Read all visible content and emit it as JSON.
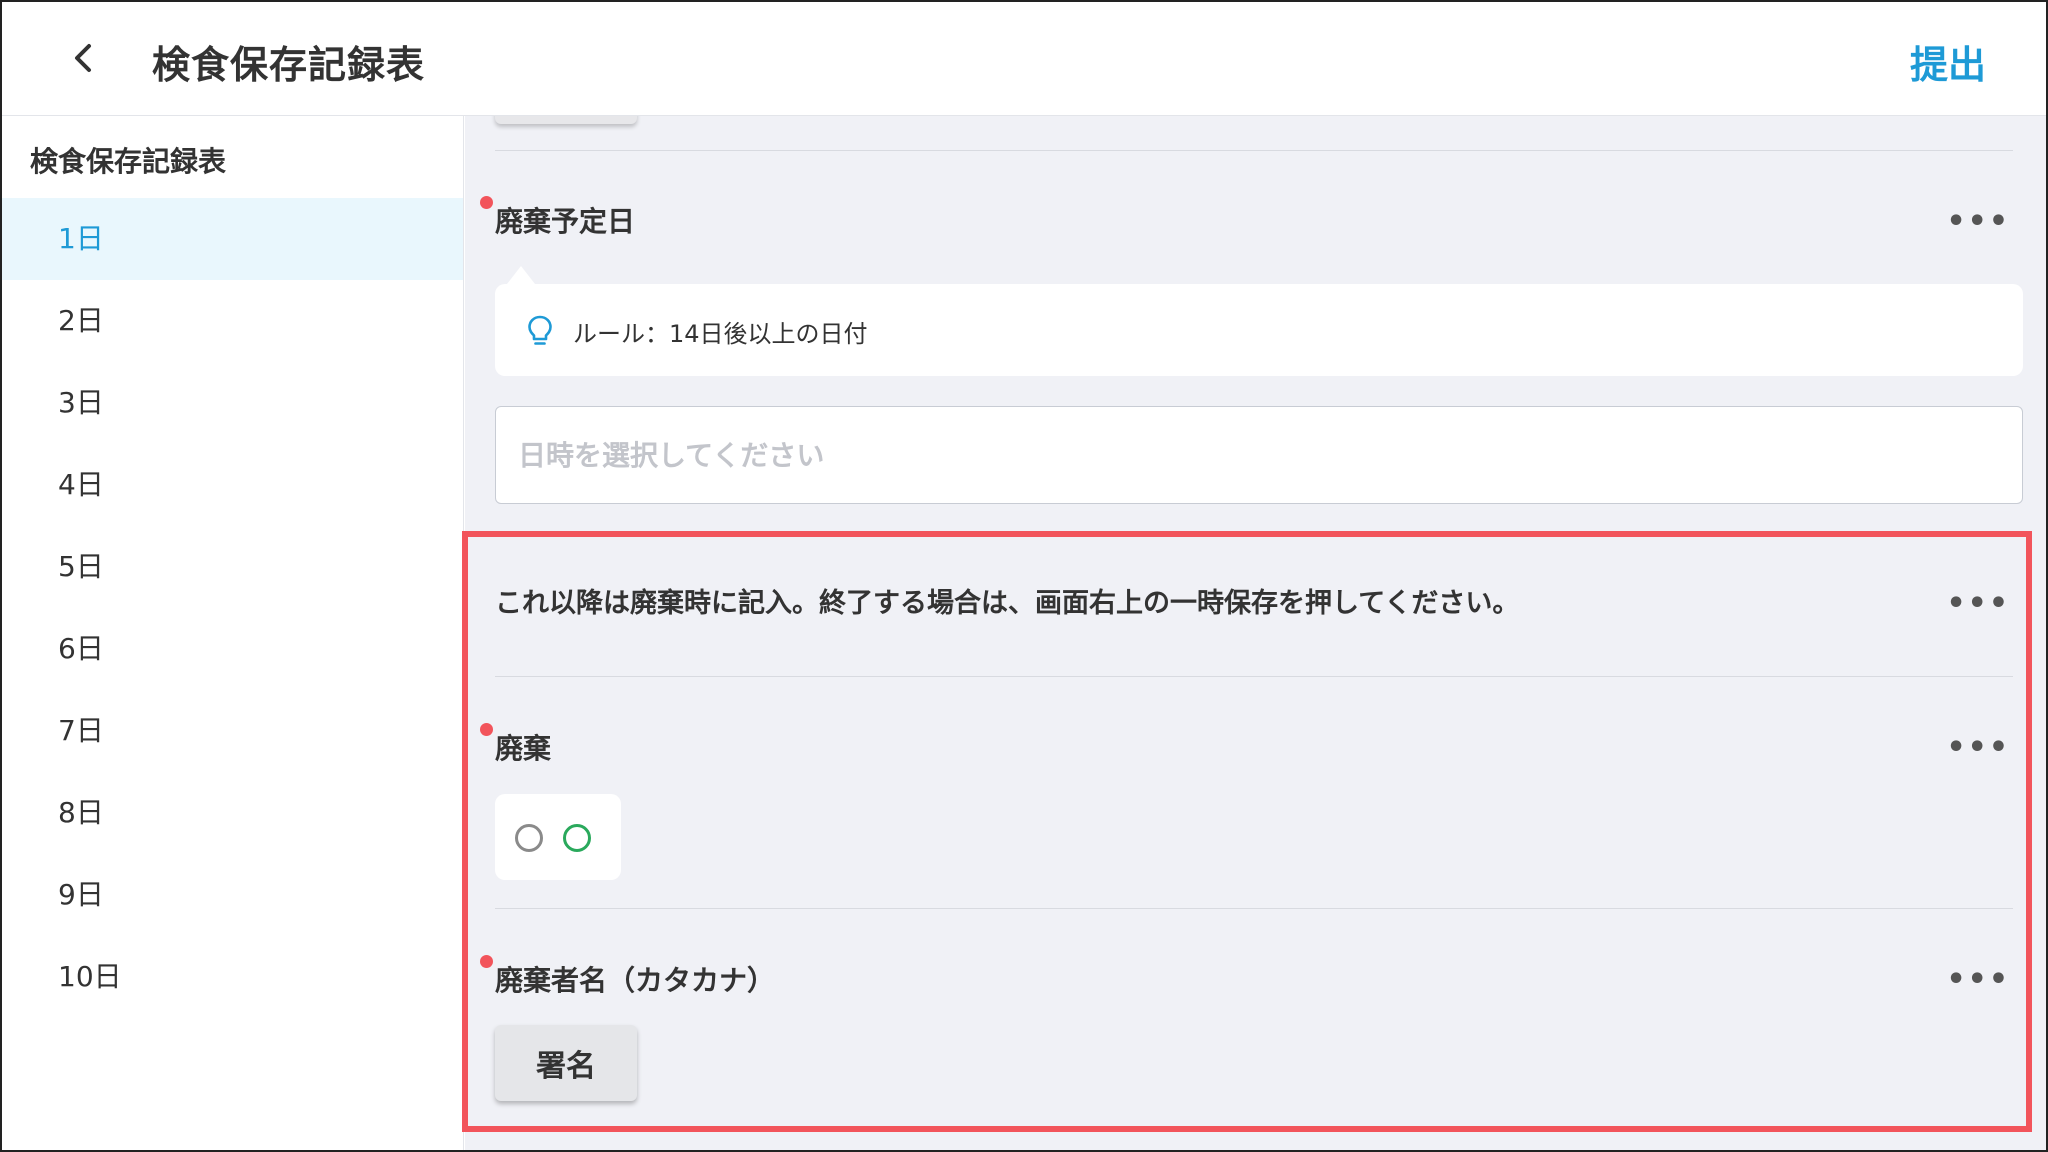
{
  "header": {
    "title": "検食保存記録表",
    "submit_label": "提出",
    "back_icon": "chevron-left-icon"
  },
  "sidebar": {
    "title": "検食保存記録表",
    "items": [
      {
        "label": "1日",
        "active": true
      },
      {
        "label": "2日"
      },
      {
        "label": "3日"
      },
      {
        "label": "4日"
      },
      {
        "label": "5日"
      },
      {
        "label": "6日"
      },
      {
        "label": "7日"
      },
      {
        "label": "8日"
      },
      {
        "label": "9日"
      },
      {
        "label": "10日"
      }
    ]
  },
  "form": {
    "disposal_date": {
      "label": "廃棄予定日",
      "required": true,
      "rule_icon": "lightbulb-icon",
      "rule_text": "ルール：14日後以上の日付",
      "placeholder": "日時を選択してください",
      "value": ""
    },
    "notice": {
      "text": "これ以降は廃棄時に記入。終了する場合は、画面右上の一時保存を押してください。"
    },
    "disposal": {
      "label": "廃棄",
      "required": true,
      "options": [
        "gray-circle",
        "green-circle"
      ]
    },
    "disposer_name": {
      "label": "廃棄者名（カタカナ）",
      "required": true,
      "sign_label": "署名"
    },
    "more_label": "•••"
  },
  "colors": {
    "accent": "#1e9ad6",
    "required": "#f2545b",
    "highlight": "#f2545b",
    "ok_green": "#2aa95c",
    "background": "#f0f1f6"
  }
}
